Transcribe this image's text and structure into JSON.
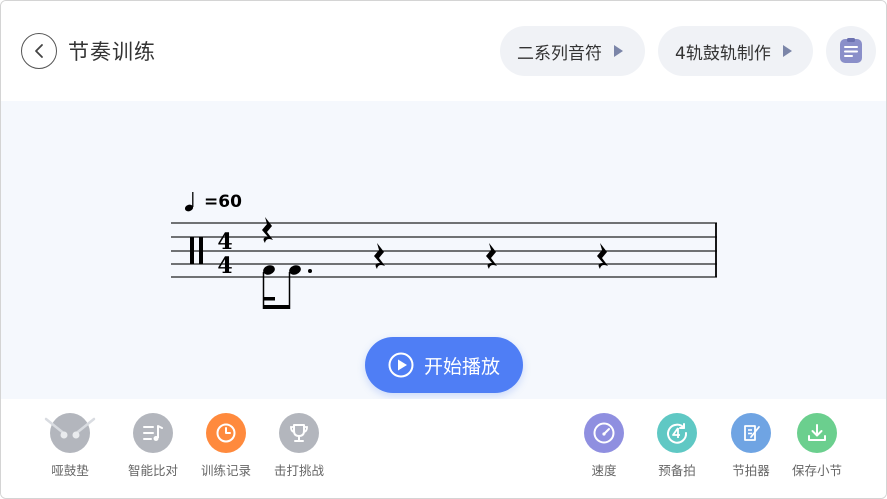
{
  "header": {
    "title": "节奏训练",
    "pill_series": "二系列音符",
    "pill_tracks": "4轨鼓轨制作"
  },
  "score": {
    "tempo": "=60",
    "time_sig_top": "4",
    "time_sig_bottom": "4"
  },
  "play_button": {
    "label": "开始播放"
  },
  "toolbar": {
    "left": [
      {
        "label": "哑鼓垫",
        "icon": "drum-pad-icon",
        "color": "#b3b6bd"
      },
      {
        "label": "智能比对",
        "icon": "music-compare-icon",
        "color": "#b3b6bd"
      },
      {
        "label": "训练记录",
        "icon": "clock-icon",
        "color": "#ff8a3d"
      },
      {
        "label": "击打挑战",
        "icon": "trophy-icon",
        "color": "#b3b6bd"
      }
    ],
    "right": [
      {
        "label": "速度",
        "icon": "speedometer-icon",
        "color": "#8f8fe0"
      },
      {
        "label": "预备拍",
        "icon": "count-in-icon",
        "color": "#5fc8c4"
      },
      {
        "label": "节拍器",
        "icon": "metronome-icon",
        "color": "#6fa4e3"
      },
      {
        "label": "保存小节",
        "icon": "download-icon",
        "color": "#6bcf8e"
      }
    ]
  }
}
